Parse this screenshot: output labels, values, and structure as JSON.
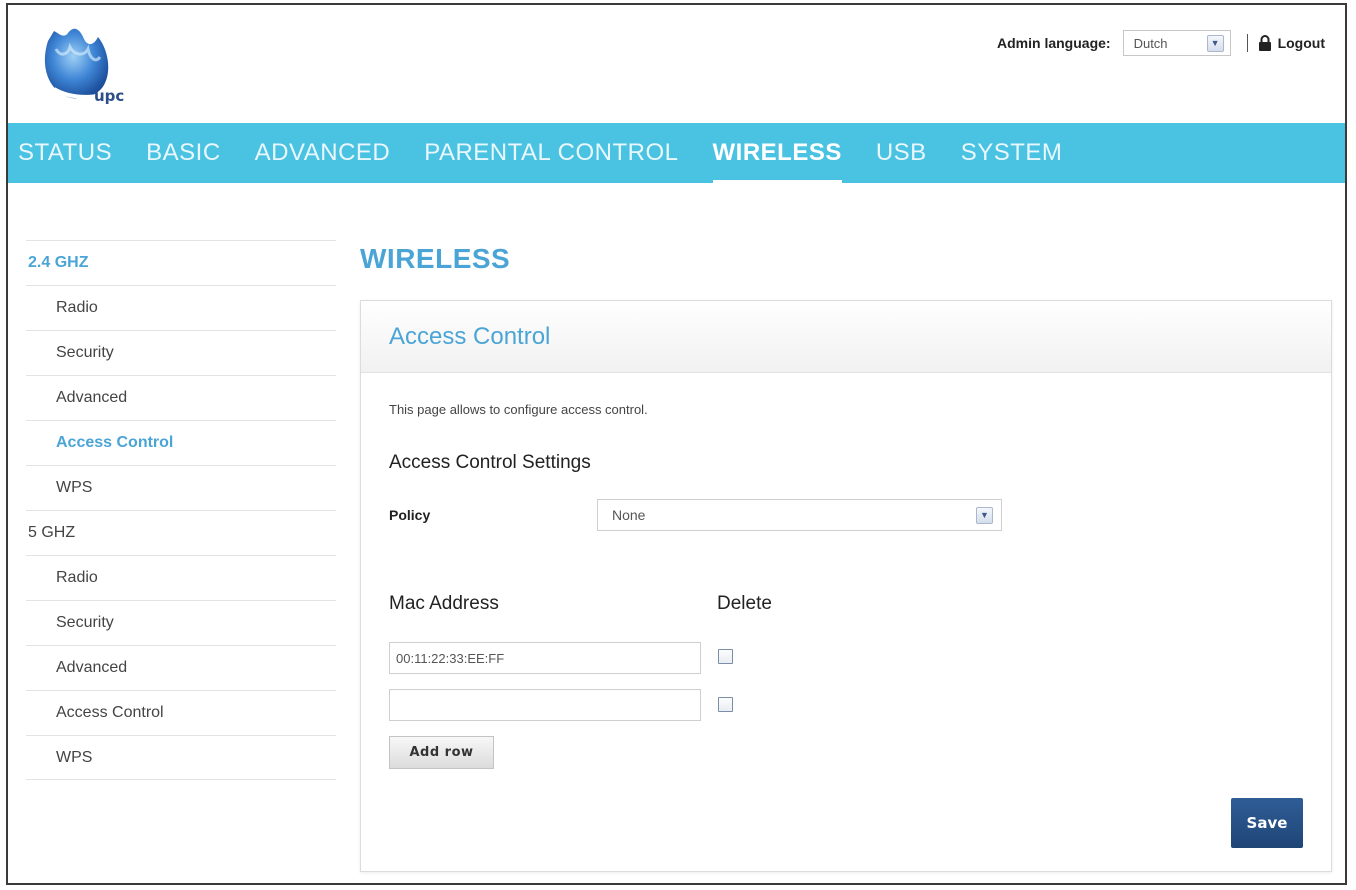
{
  "brand": {
    "name": "upc"
  },
  "header": {
    "admin_language_label": "Admin language:",
    "admin_language_value": "Dutch",
    "logout_label": "Logout"
  },
  "nav": {
    "items": [
      {
        "label": "STATUS"
      },
      {
        "label": "BASIC"
      },
      {
        "label": "ADVANCED"
      },
      {
        "label": "PARENTAL CONTROL"
      },
      {
        "label": "WIRELESS",
        "active": true
      },
      {
        "label": "USB"
      },
      {
        "label": "SYSTEM"
      }
    ]
  },
  "sidebar": {
    "groups": [
      {
        "label": "2.4 GHZ",
        "items": [
          "Radio",
          "Security",
          "Advanced",
          "Access Control",
          "WPS"
        ],
        "active_item": "Access Control"
      },
      {
        "label": "5 GHZ",
        "items": [
          "Radio",
          "Security",
          "Advanced",
          "Access Control",
          "WPS"
        ]
      }
    ]
  },
  "main": {
    "page_title": "WIRELESS",
    "panel_title": "Access Control",
    "description": "This page allows to configure access control.",
    "settings_title": "Access Control Settings",
    "policy_label": "Policy",
    "policy_value": "None",
    "mac_column": "Mac Address",
    "delete_column": "Delete",
    "mac_rows": [
      {
        "value": "00:11:22:33:EE:FF",
        "delete_checked": false
      },
      {
        "value": "",
        "delete_checked": false
      }
    ],
    "add_row_label": "Add row",
    "save_label": "Save"
  },
  "colors": {
    "nav_bg": "#4ac3e2",
    "accent": "#4aa5d6",
    "save_bg": "#1f4577"
  }
}
